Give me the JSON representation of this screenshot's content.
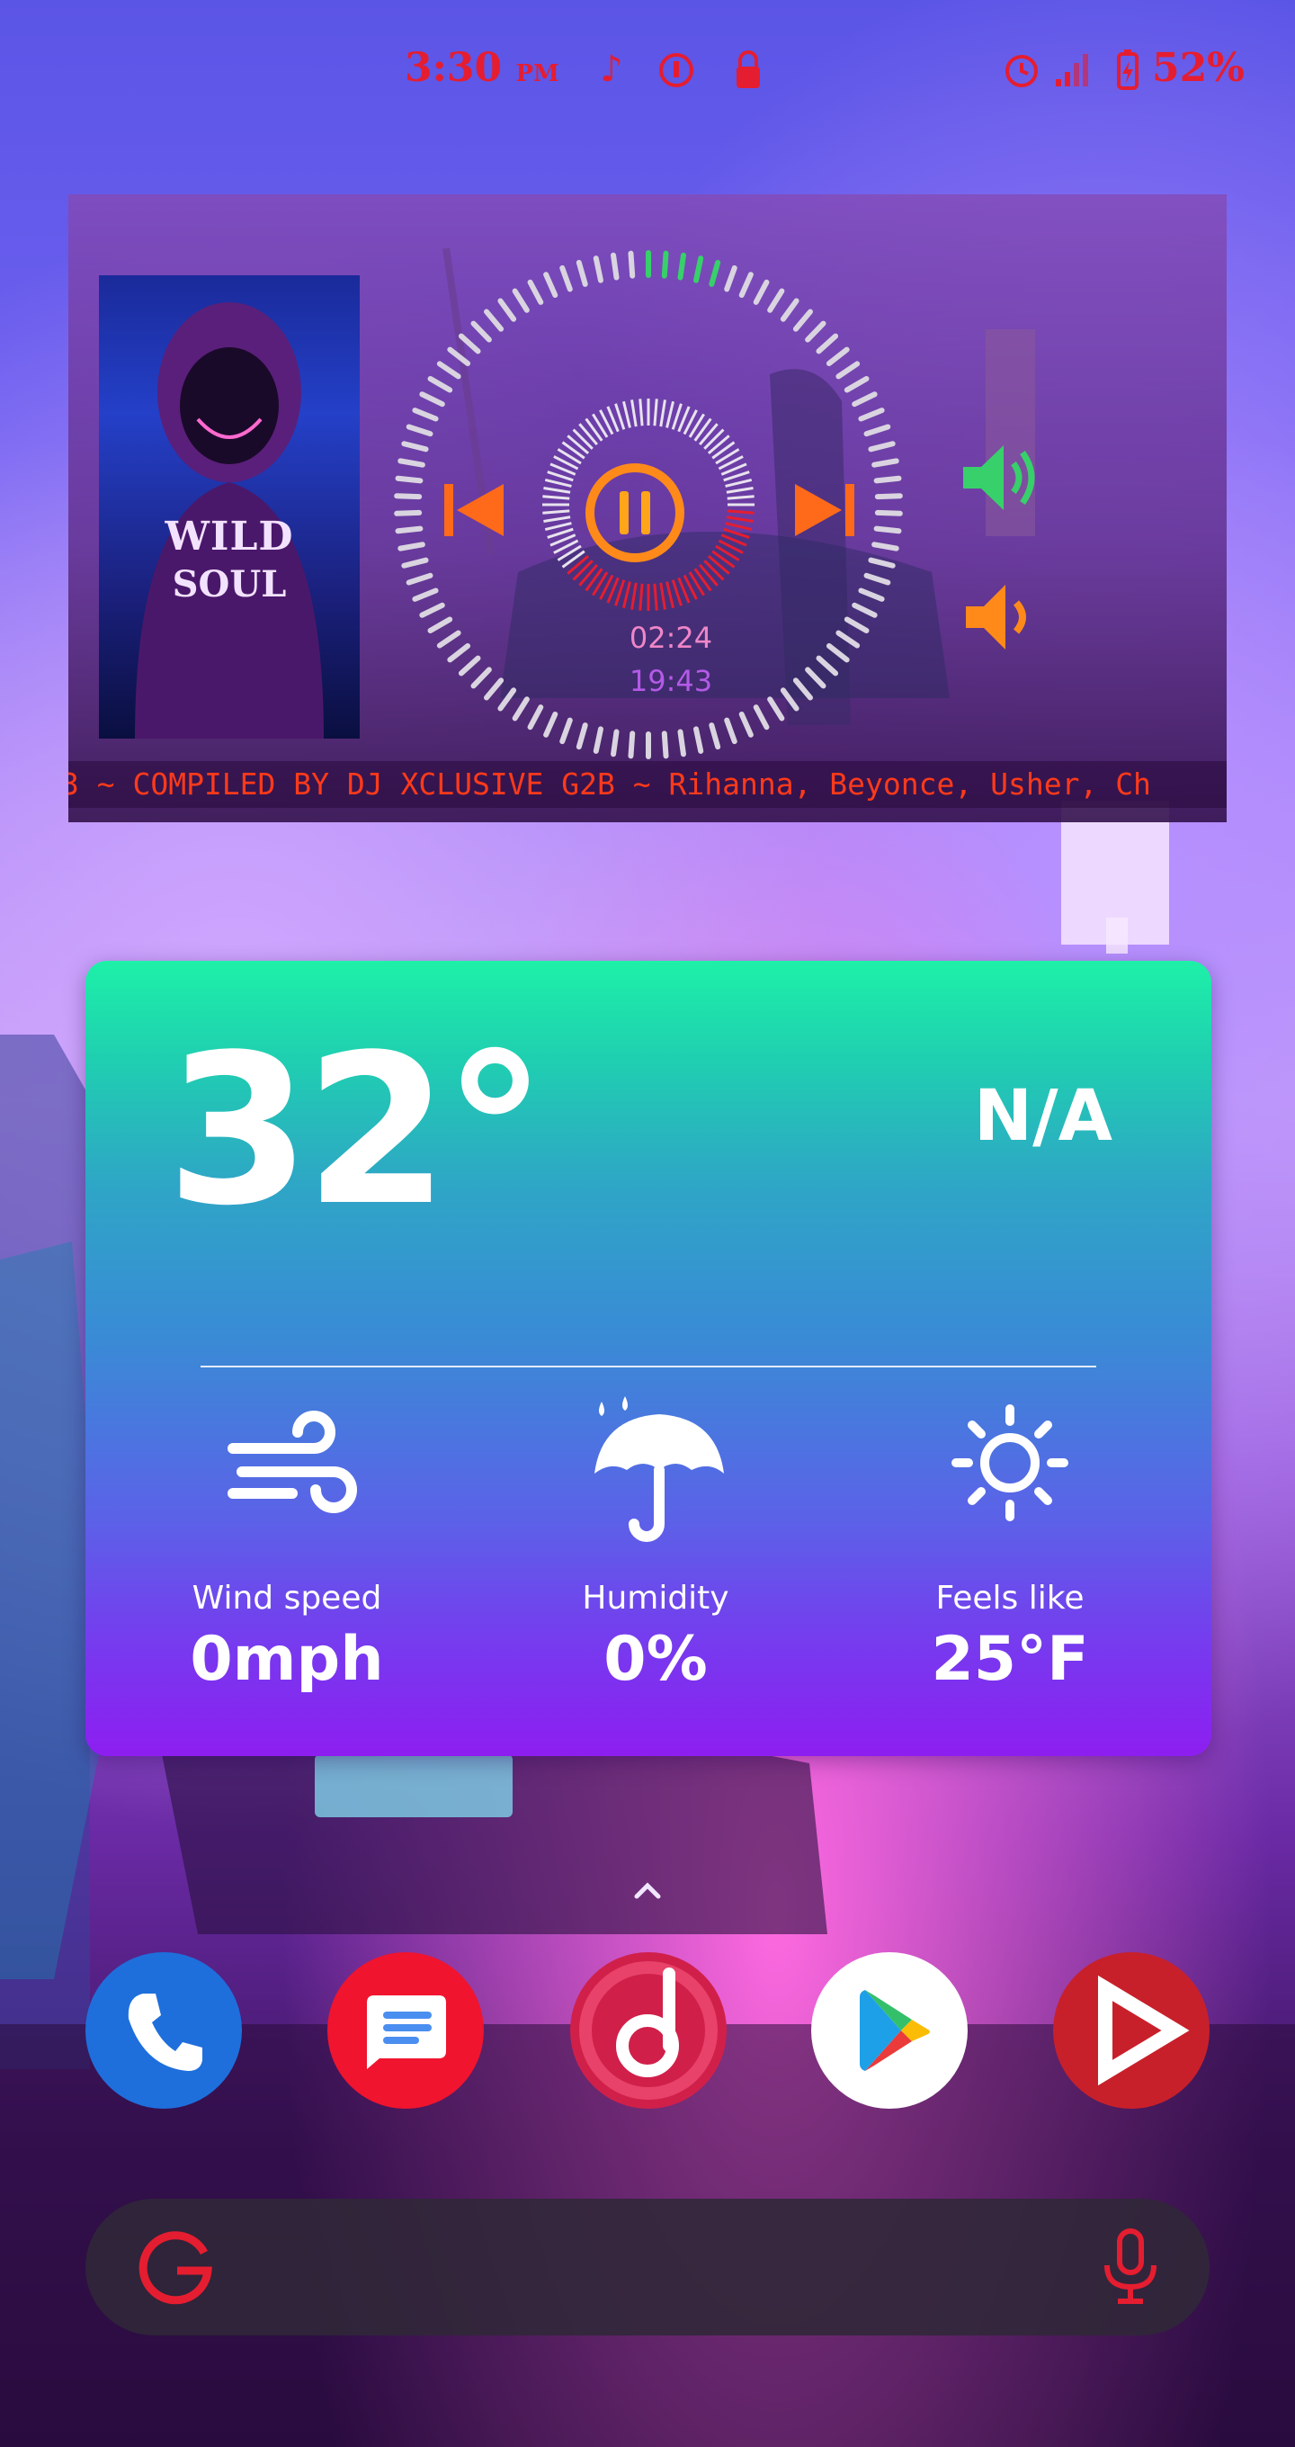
{
  "status_bar": {
    "time": "3:30",
    "ampm": "PM",
    "icons_left": [
      "music-note-icon",
      "circle-info-icon",
      "lock-icon"
    ],
    "icons_right": [
      "alarm-icon",
      "signal-icon",
      "battery-icon"
    ],
    "battery": "52%"
  },
  "music_widget": {
    "album_art": {
      "line1": "WILD",
      "line2": "SOUL"
    },
    "elapsed": "02:24",
    "total": "19:43",
    "marquee": "3 ~ COMPILED BY DJ XCLUSIVE G2B ~ Rihanna, Beyonce, Usher, Ch",
    "controls": [
      "previous-icon",
      "pause-icon",
      "next-icon",
      "volume-up-icon",
      "volume-down-icon"
    ],
    "colors": {
      "accent": "#ff7a1a",
      "red": "#e51d30",
      "green": "#38d06a"
    }
  },
  "weather_widget": {
    "temperature": "32°",
    "condition": "N/A",
    "stats": [
      {
        "icon": "wind-icon",
        "label": "Wind speed",
        "value": "0mph"
      },
      {
        "icon": "umbrella-icon",
        "label": "Humidity",
        "value": "0%"
      },
      {
        "icon": "sun-icon",
        "label": "Feels like",
        "value": "25°F"
      }
    ]
  },
  "dock": {
    "apps": [
      {
        "name": "Phone",
        "icon": "phone-icon",
        "color": "#1e6fdc"
      },
      {
        "name": "Messages",
        "icon": "messages-icon",
        "color": "#f0142e"
      },
      {
        "name": "Music",
        "icon": "music-app-icon",
        "color": "#d0204a"
      },
      {
        "name": "Play Store",
        "icon": "play-store-icon",
        "color": "#ffffff"
      },
      {
        "name": "Video",
        "icon": "video-play-icon",
        "color": "#c8202a"
      }
    ]
  },
  "search_bar": {
    "g_letter": "G",
    "icons": [
      "google-g-icon",
      "microphone-icon"
    ]
  }
}
